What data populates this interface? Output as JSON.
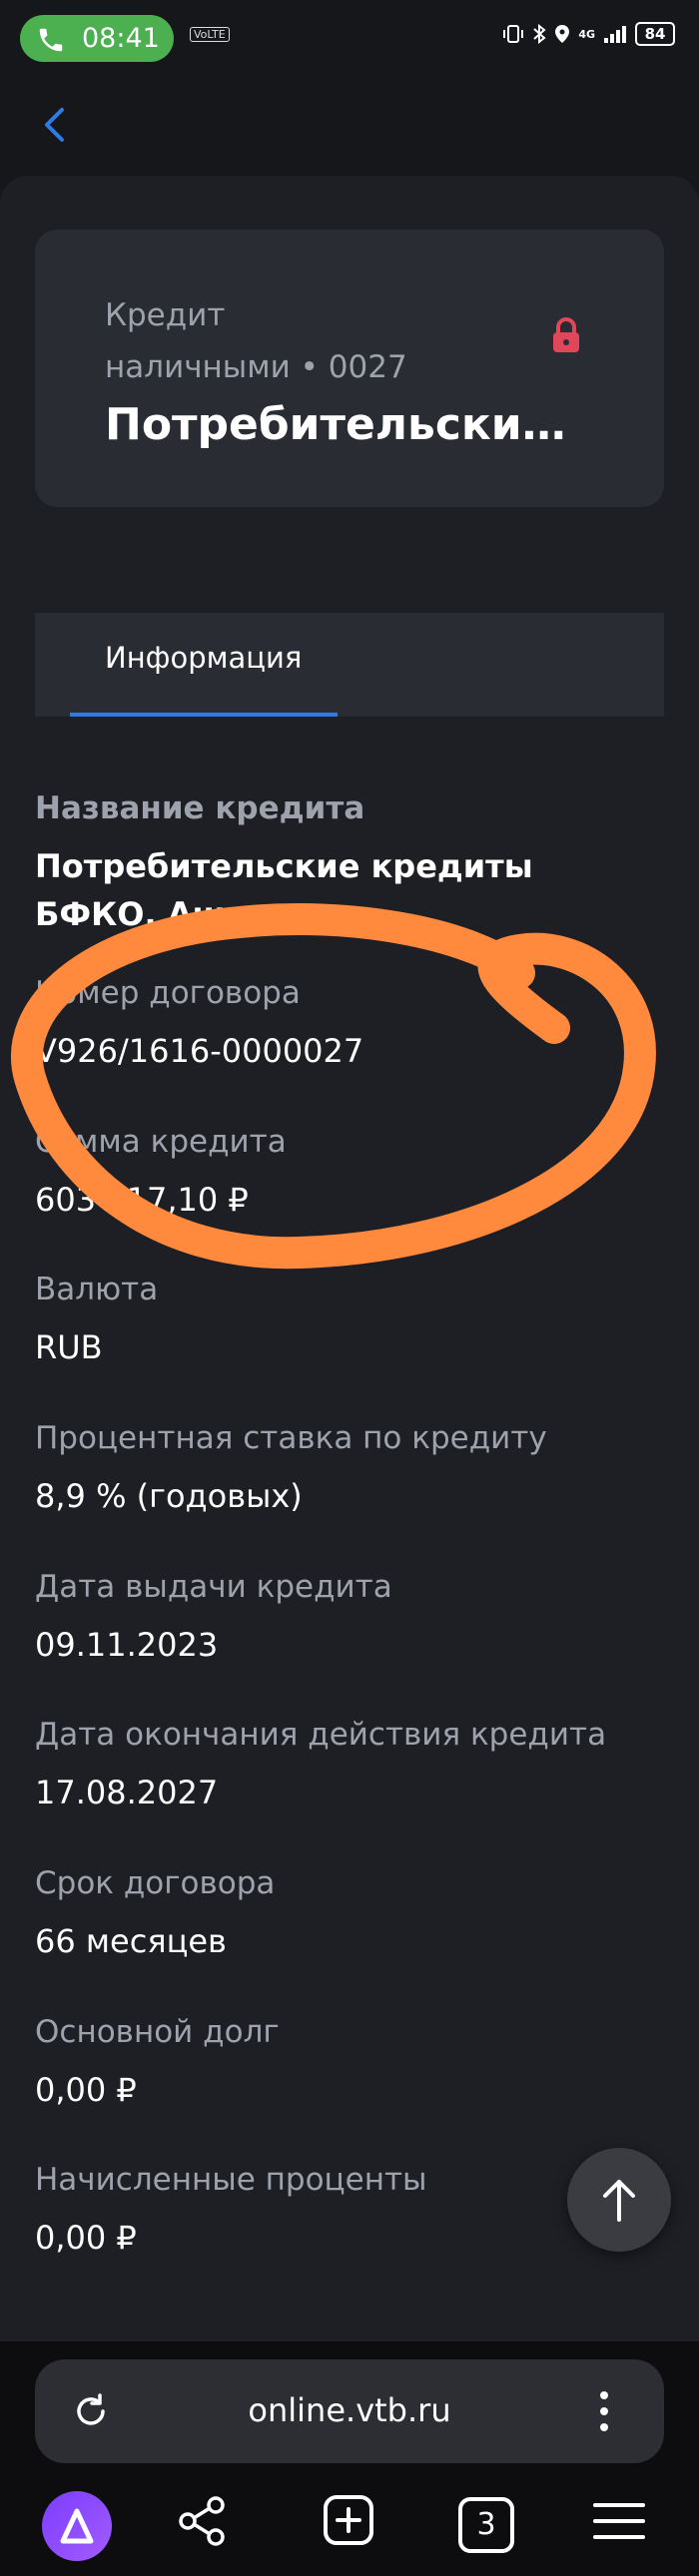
{
  "status_bar": {
    "time": "08:41",
    "volte": "VoLTE",
    "network": "4G",
    "battery": "84"
  },
  "product": {
    "type_line1": "Кредит",
    "type_line2": "наличными • 0027",
    "name": "Потребительские кредиты БФКО. Аннуитет"
  },
  "tabs": [
    {
      "label": "Информация",
      "active": true
    }
  ],
  "fields": [
    {
      "label": "Название кредита",
      "value": "Потребительские кредиты БФКО. Аннуит..."
    },
    {
      "label": "Номер договора",
      "value": "V926/1616-0000027"
    },
    {
      "label": "Сумма кредита",
      "value": "603 217,10 ₽"
    },
    {
      "label": "Валюта",
      "value": "RUB"
    },
    {
      "label": "Процентная ставка по кредиту",
      "value": "8,9 % (годовых)"
    },
    {
      "label": "Дата выдачи кредита",
      "value": "09.11.2023"
    },
    {
      "label": "Дата окончания действия кредита",
      "value": "17.08.2027"
    },
    {
      "label": "Срок договора",
      "value": "66 месяцев"
    },
    {
      "label": "Основной долг",
      "value": "0,00 ₽"
    },
    {
      "label": "Начисленные проценты",
      "value": "0,00 ₽"
    }
  ],
  "browser": {
    "url": "online.vtb.ru",
    "tabs_count": "3"
  },
  "colors": {
    "background": "#16171b",
    "card": "#2a2c33",
    "accent": "#2e7be6",
    "lock": "#e0475a",
    "scribble": "#ff8a3d"
  }
}
